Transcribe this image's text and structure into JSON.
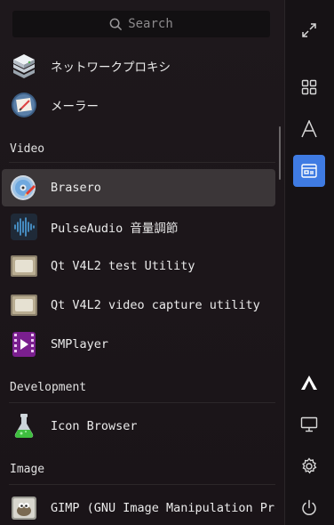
{
  "search": {
    "placeholder": "Search"
  },
  "apps_top": [
    {
      "label": "ネットワークプロキシ",
      "icon": "network-proxy-icon"
    },
    {
      "label": "メーラー",
      "icon": "mailer-icon"
    }
  ],
  "sections": {
    "video": "Video",
    "development": "Development",
    "image": "Image"
  },
  "video_apps": [
    {
      "label": "Brasero",
      "icon": "brasero-icon",
      "selected": true
    },
    {
      "label": "PulseAudio 音量調節",
      "icon": "pulseaudio-icon"
    },
    {
      "label": "Qt V4L2 test Utility",
      "icon": "qt-v4l2-icon"
    },
    {
      "label": "Qt V4L2 video capture utility",
      "icon": "qt-v4l2-capture-icon"
    },
    {
      "label": "SMPlayer",
      "icon": "smplayer-icon"
    }
  ],
  "development_apps": [
    {
      "label": "Icon Browser",
      "icon": "icon-browser-icon"
    }
  ],
  "image_apps": [
    {
      "label": "GIMP (GNU Image Manipulation Program)",
      "icon": "gimp-icon"
    }
  ],
  "sidebar": {
    "top": [
      "expand-icon",
      "grid-view-icon",
      "alphabet-view-icon",
      "category-view-icon"
    ],
    "active": "category-view-icon",
    "bottom": [
      "arch-logo-icon",
      "computer-icon",
      "settings-icon",
      "power-icon"
    ]
  },
  "colors": {
    "accent": "#3f7be3",
    "selected_row": "#3b3638"
  }
}
